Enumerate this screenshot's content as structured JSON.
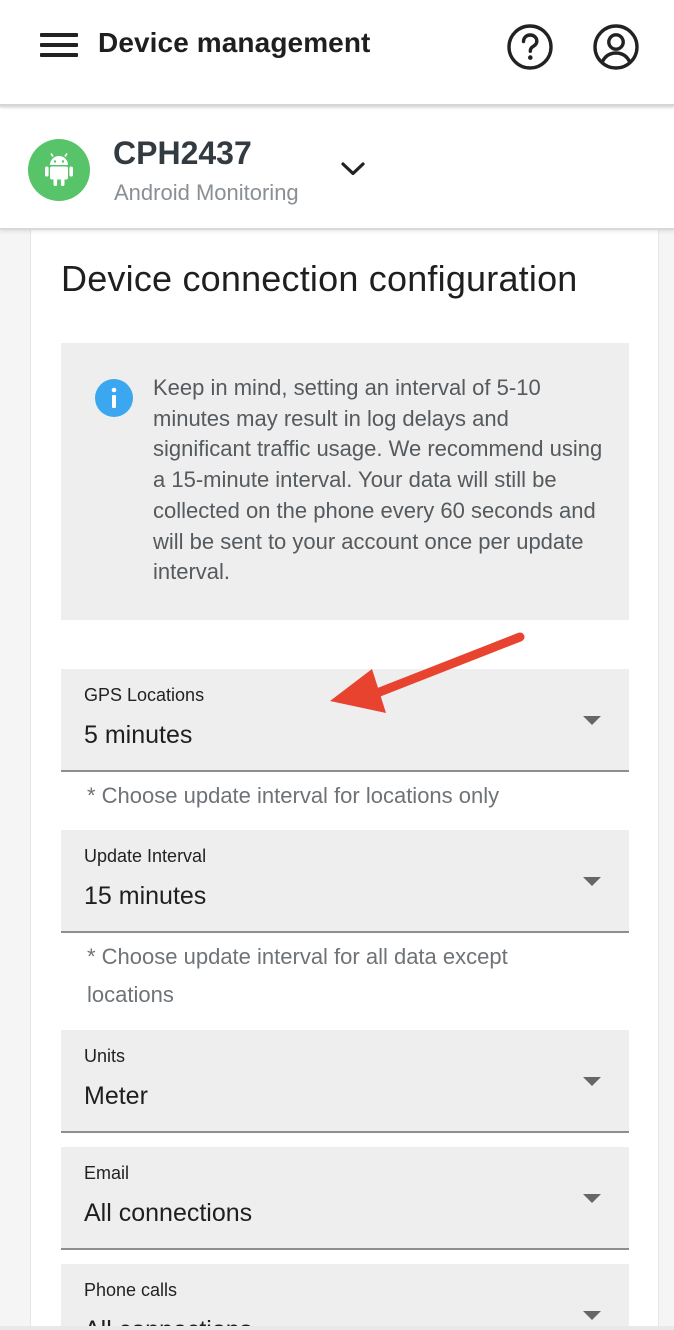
{
  "header": {
    "title": "Device management",
    "help_icon": "help-circle-icon",
    "account_icon": "account-circle-icon"
  },
  "device": {
    "name": "CPH2437",
    "subtitle": "Android Monitoring",
    "icon": "android-icon",
    "avatar_color": "#57c46a"
  },
  "page": {
    "title": "Device connection configuration",
    "info": {
      "icon": "info-icon",
      "icon_color": "#3aa7f0",
      "text": "Keep in mind, setting an interval of 5-10 minutes may result in log delays and significant traffic usage. We recommend using a 15-minute interval. Your data will still be collected on the phone every 60 seconds and will be sent to your account once per update interval."
    },
    "fields": [
      {
        "label": "GPS Locations",
        "value": "5 minutes",
        "helper": "* Choose update interval for locations only"
      },
      {
        "label": "Update Interval",
        "value": "15 minutes",
        "helper": "* Choose update interval for all data except locations"
      },
      {
        "label": "Units",
        "value": "Meter"
      },
      {
        "label": "Email",
        "value": "All connections"
      },
      {
        "label": "Phone calls",
        "value": "All connections"
      }
    ]
  },
  "annotation": {
    "arrow_color": "#e8432e"
  }
}
